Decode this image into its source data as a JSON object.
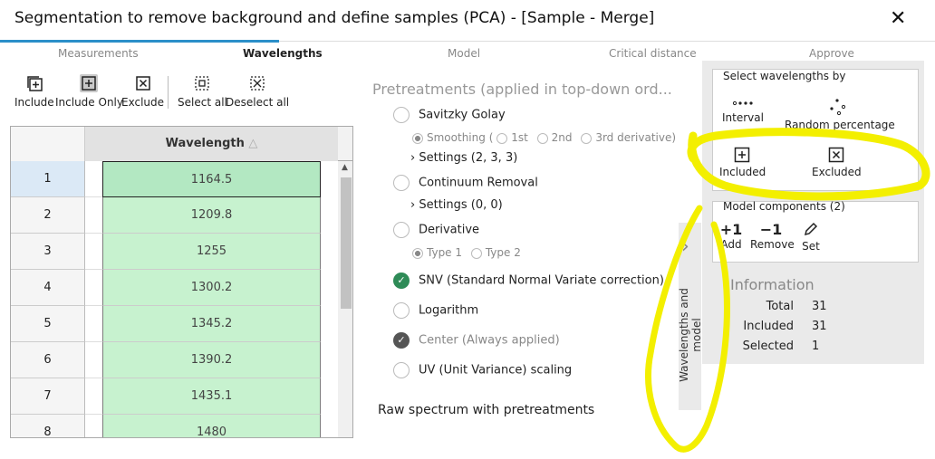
{
  "window": {
    "title": "Segmentation to remove background and define samples (PCA) - [Sample - Merge]",
    "close_glyph": "✕"
  },
  "tabs": [
    {
      "label": "Measurements"
    },
    {
      "label": "Wavelengths"
    },
    {
      "label": "Model"
    },
    {
      "label": "Critical distance"
    },
    {
      "label": "Approve"
    }
  ],
  "toolbar": {
    "include": "Include",
    "include_only": "Include Only",
    "exclude": "Exclude",
    "select_all": "Select all",
    "deselect_all": "Deselect all"
  },
  "grid": {
    "column_header": "Wavelength",
    "rows": [
      {
        "n": "1",
        "value": "1164.5"
      },
      {
        "n": "2",
        "value": "1209.8"
      },
      {
        "n": "3",
        "value": "1255"
      },
      {
        "n": "4",
        "value": "1300.2"
      },
      {
        "n": "5",
        "value": "1345.2"
      },
      {
        "n": "6",
        "value": "1390.2"
      },
      {
        "n": "7",
        "value": "1435.1"
      },
      {
        "n": "8",
        "value": "1480"
      }
    ]
  },
  "pretreatments": {
    "title": "Pretreatments (applied in top-down ord...",
    "savitzky": "Savitzky Golay",
    "smoothing": "Smoothing",
    "first": "1st",
    "second": "2nd",
    "third": "3rd derivative)",
    "open_paren": "(",
    "settings_sg": "Settings (2, 3, 3)",
    "continuum": "Continuum Removal",
    "settings_cr": "Settings (0, 0)",
    "derivative": "Derivative",
    "type1": "Type 1",
    "type2": "Type 2",
    "snv": "SNV (Standard Normal Variate correction)",
    "logarithm": "Logarithm",
    "center": "Center (Always applied)",
    "uv": "UV (Unit Variance) scaling"
  },
  "raw_title": "Raw spectrum with pretreatments",
  "side_tab": {
    "label": "Wavelengths and model"
  },
  "select_by": {
    "title": "Select wavelengths by",
    "interval": "Interval",
    "random": "Random percentage",
    "included": "Included",
    "excluded": "Excluded"
  },
  "model_components": {
    "title": "Model components (2)",
    "add_glyph": "+1",
    "remove_glyph": "−1",
    "add": "Add",
    "remove": "Remove",
    "set": "Set"
  },
  "information": {
    "title": "Information",
    "total_label": "Total",
    "total": "31",
    "included_label": "Included",
    "included": "31",
    "selected_label": "Selected",
    "selected": "1"
  },
  "colors": {
    "accent": "#2b8fc9",
    "cell_green": "#c7f2cf",
    "check_green": "#2e8b57",
    "highlight": "#f3ef00"
  }
}
